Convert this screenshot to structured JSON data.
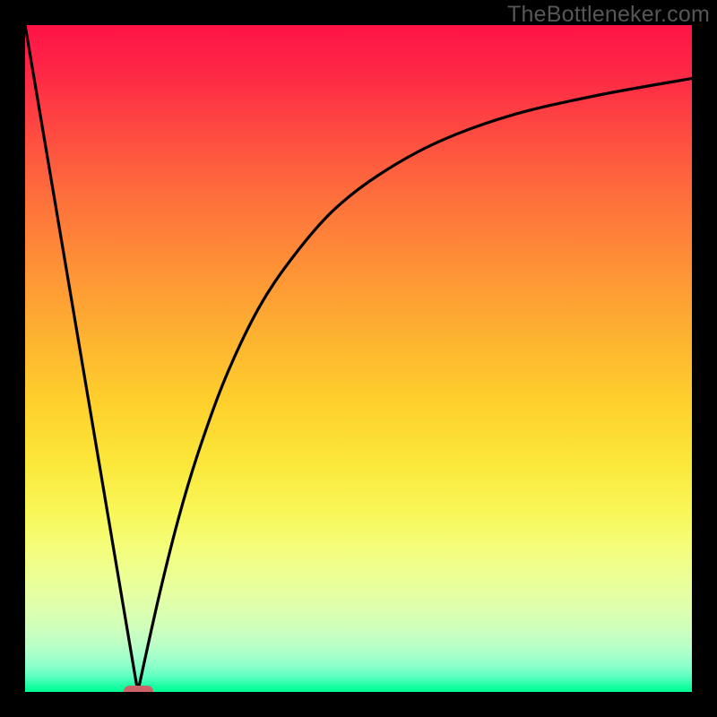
{
  "watermark": "TheBottleneker.com",
  "chart_data": {
    "type": "line",
    "title": "",
    "xlabel": "",
    "ylabel": "",
    "xlim": [
      0,
      100
    ],
    "ylim": [
      0,
      100
    ],
    "grid": false,
    "background": "vertical gradient red-orange-yellow-green representing bottleneck severity (red=100 high, green=0 low)",
    "series": [
      {
        "name": "left-branch",
        "x": [
          0,
          16.9
        ],
        "y": [
          100,
          0
        ],
        "note": "straight line from top-left to valley"
      },
      {
        "name": "right-branch",
        "x": [
          16.9,
          20,
          23,
          26,
          30,
          35,
          40,
          46,
          53,
          62,
          73,
          86,
          100
        ],
        "y": [
          0,
          14,
          26,
          36,
          47,
          57.5,
          65,
          72,
          77.5,
          82.5,
          86.5,
          89.5,
          92
        ],
        "note": "rising saturating curve from valley toward upper-right"
      }
    ],
    "marker": {
      "x_range": [
        14.8,
        19.2
      ],
      "y": 0,
      "color": "#cc6366",
      "shape": "pill"
    }
  },
  "colors": {
    "frame": "#000000",
    "curve": "#000000",
    "marker": "#cc6366",
    "watermark": "#565656"
  }
}
